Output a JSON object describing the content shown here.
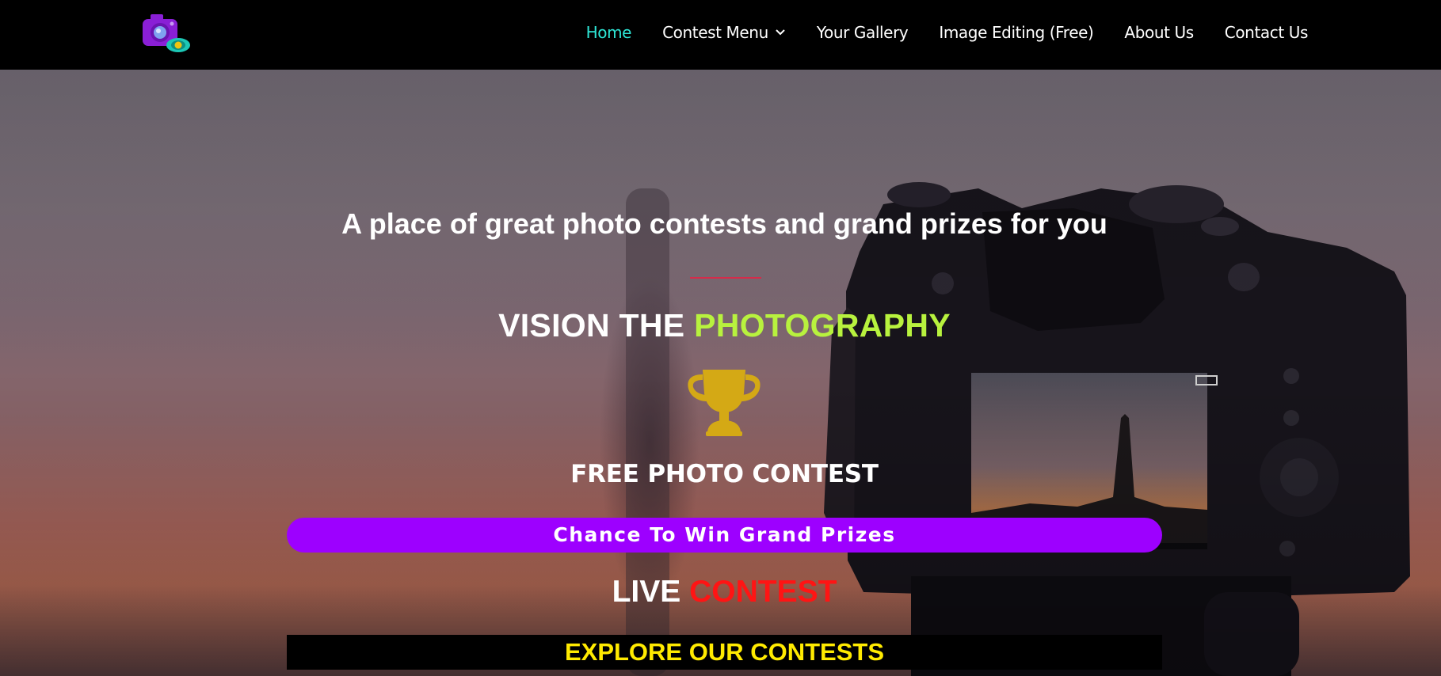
{
  "header": {
    "logo": {
      "icon": "camera-eye-logo-icon",
      "colors": {
        "camera": "#8a1fd6",
        "eye": "#1cc7b5",
        "pupil": "#f1c40f"
      }
    },
    "nav": [
      {
        "label": "Home",
        "active": true
      },
      {
        "label": "Contest Menu",
        "has_dropdown": true
      },
      {
        "label": "Your Gallery"
      },
      {
        "label": "Image Editing (Free)"
      },
      {
        "label": "About Us"
      },
      {
        "label": "Contact Us"
      }
    ],
    "active_color": "#2ee6d6"
  },
  "hero": {
    "tagline": "A place of great photo contests and grand prizes for you",
    "heading_part1": "VISION THE ",
    "heading_part2": "PHOTOGRAPHY",
    "trophy_icon": "trophy-icon",
    "subheading": "FREE PHOTO CONTEST",
    "prize_button": "Chance To Win Grand Prizes",
    "live_part1": "LIVE ",
    "live_part2": "CONTEST",
    "explore_button": "EXPLORE OUR CONTESTS",
    "colors": {
      "highlight": "#b8f23e",
      "trophy": "#d4a915",
      "prize_bar": "#9d00ff",
      "live_red": "#ff1414",
      "explore_text": "#ffea00",
      "divider": "#d62b4a"
    }
  }
}
